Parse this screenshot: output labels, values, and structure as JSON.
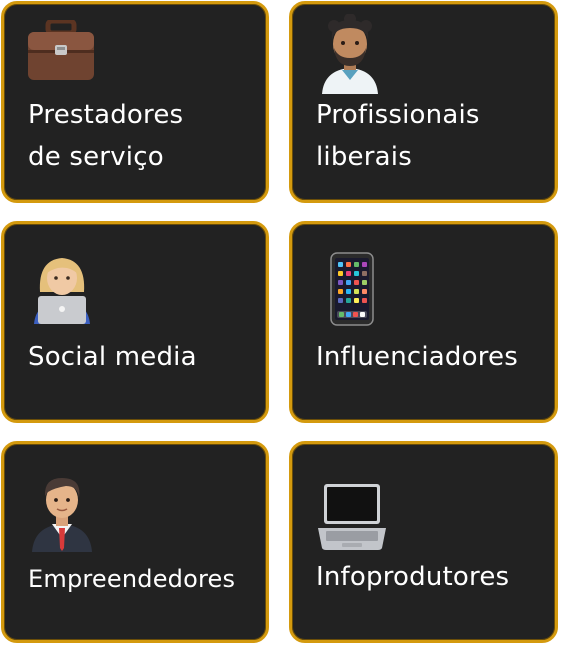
{
  "cards": [
    {
      "label": "Prestadores\nde serviço",
      "icon": "briefcase-icon"
    },
    {
      "label": "Profissionais\nliberais",
      "icon": "doctor-icon"
    },
    {
      "label": "Social media",
      "icon": "woman-laptop-icon"
    },
    {
      "label": "Influenciadores",
      "icon": "smartphone-icon"
    },
    {
      "label": "Empreendedores",
      "icon": "businessman-icon"
    },
    {
      "label": "Infoprodutores",
      "icon": "laptop-icon"
    }
  ],
  "colors": {
    "card_background": "#222222",
    "card_border": "#d49a0e",
    "text": "#ffffff"
  }
}
